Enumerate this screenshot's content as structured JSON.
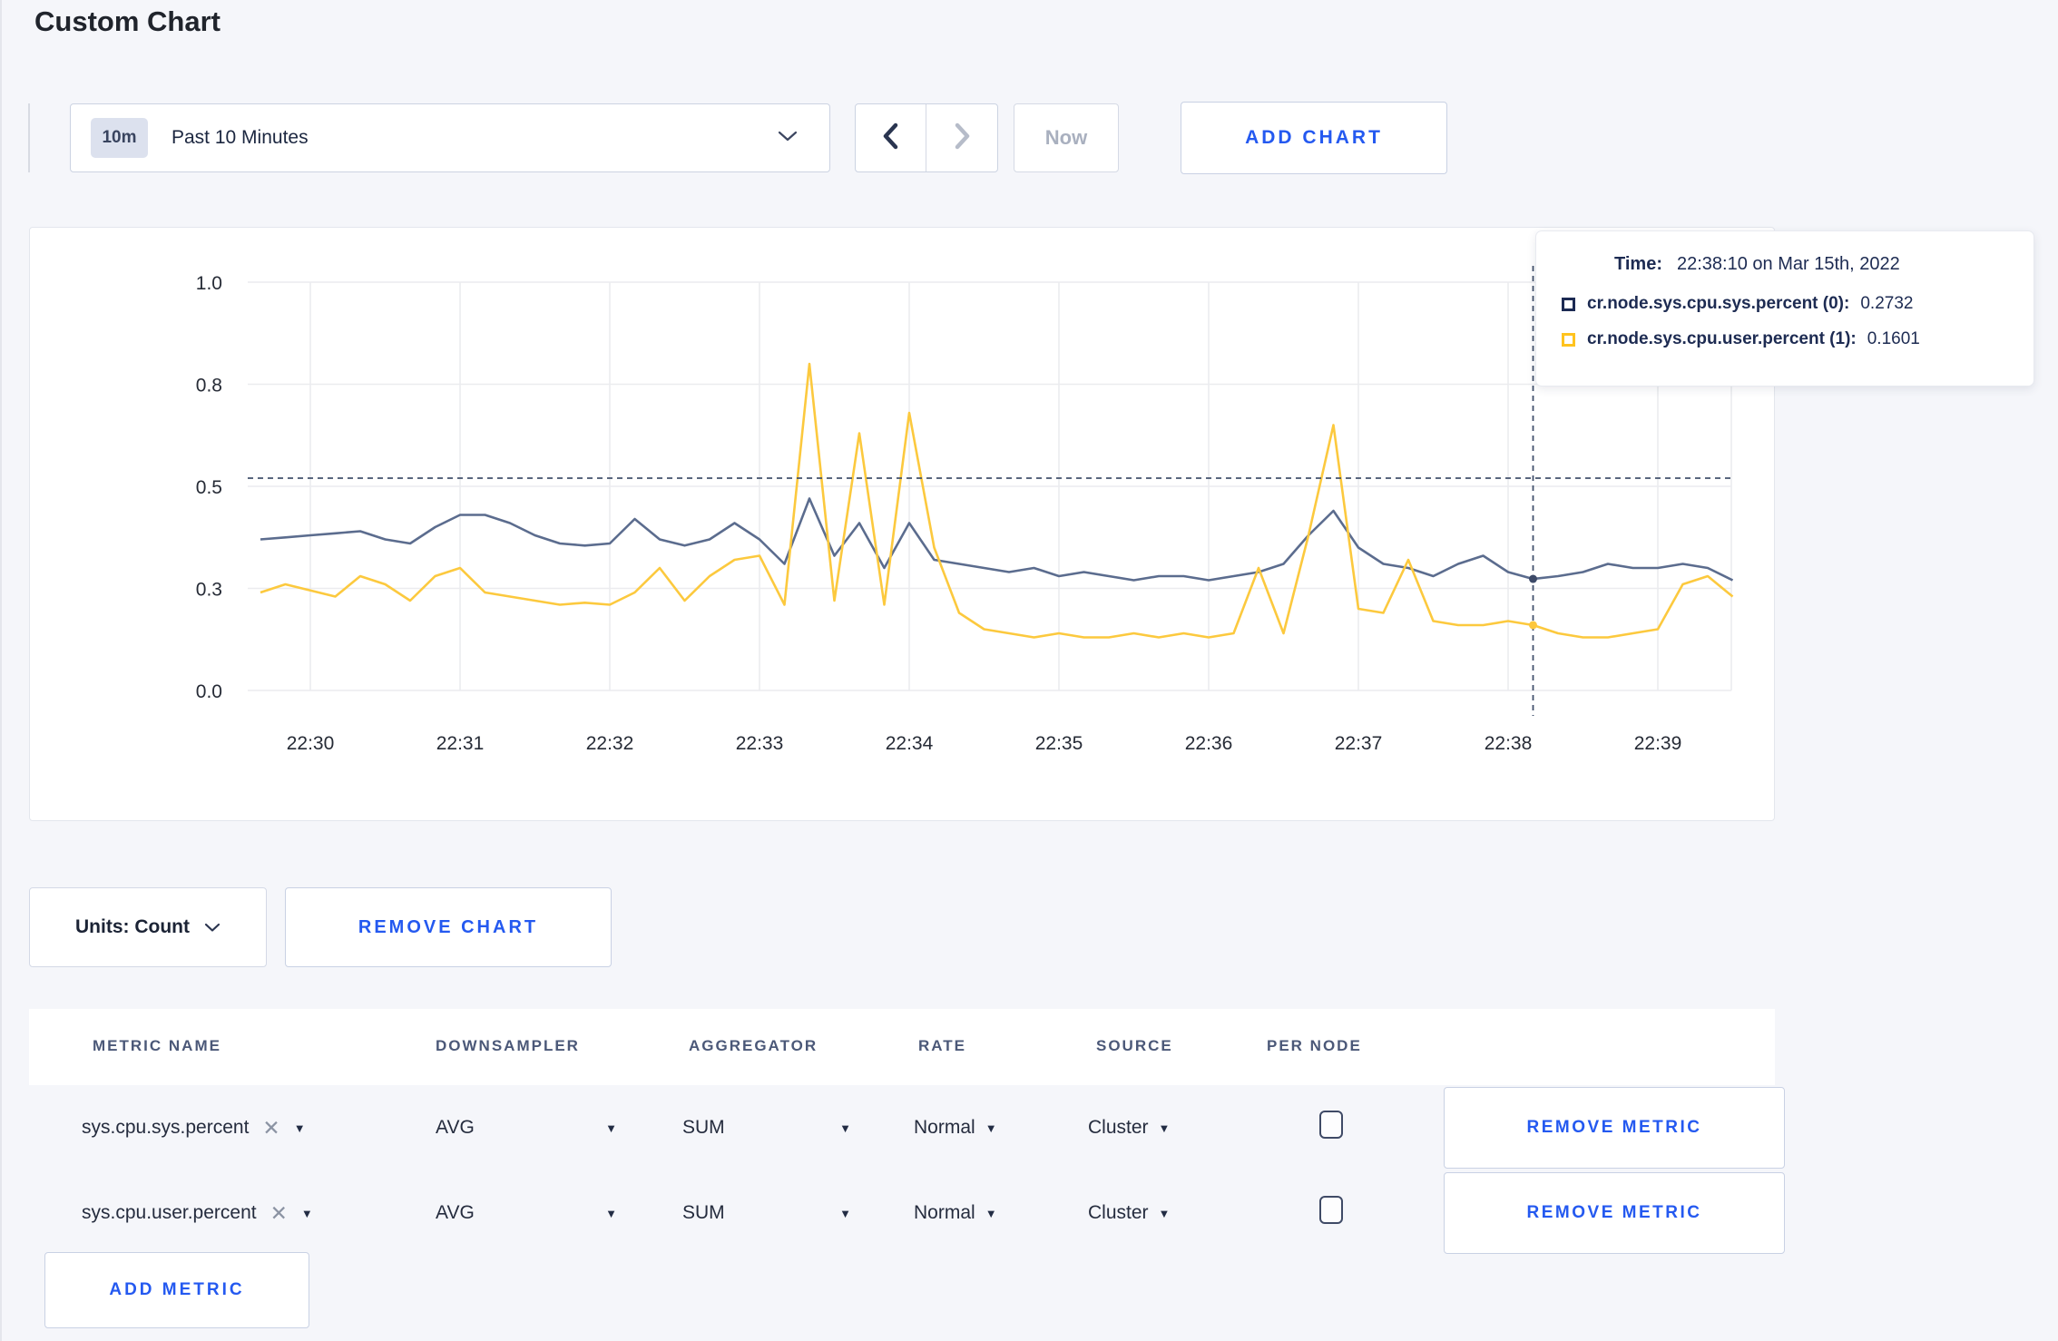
{
  "page": {
    "title": "Custom Chart"
  },
  "toolbar": {
    "range_badge": "10m",
    "range_label": "Past 10 Minutes",
    "now_label": "Now",
    "add_chart_label": "ADD CHART"
  },
  "icons": {
    "clear": "✕",
    "dropdown_arrow": "▼"
  },
  "tooltip": {
    "time_label": "Time:",
    "time_value": "22:38:10 on Mar 15th, 2022",
    "series": [
      {
        "label": "cr.node.sys.cpu.sys.percent (0):",
        "value": "0.2732",
        "color": "#1c2a53"
      },
      {
        "label": "cr.node.sys.cpu.user.percent (1):",
        "value": "0.1601",
        "color": "#ffc31e"
      }
    ]
  },
  "chart_controls": {
    "units_label": "Units: Count",
    "remove_chart_label": "REMOVE CHART"
  },
  "metrics_table": {
    "headers": [
      "METRIC NAME",
      "DOWNSAMPLER",
      "AGGREGATOR",
      "RATE",
      "SOURCE",
      "PER NODE"
    ],
    "rows": [
      {
        "metric": "sys.cpu.sys.percent",
        "downsampler": "AVG",
        "aggregator": "SUM",
        "rate": "Normal",
        "source": "Cluster",
        "per_node_checked": false,
        "remove_label": "REMOVE METRIC"
      },
      {
        "metric": "sys.cpu.user.percent",
        "downsampler": "AVG",
        "aggregator": "SUM",
        "rate": "Normal",
        "source": "Cluster",
        "per_node_checked": false,
        "remove_label": "REMOVE METRIC"
      }
    ],
    "add_metric_label": "ADD METRIC"
  },
  "chart_data": {
    "type": "line",
    "title": "",
    "xlabel": "",
    "ylabel": "",
    "grid": true,
    "legend_position": "none",
    "grid_color": "#ebecef",
    "x_axis": {
      "tick_labels": [
        "22:30",
        "22:31",
        "22:32",
        "22:33",
        "22:34",
        "22:35",
        "22:36",
        "22:37",
        "22:38",
        "22:39"
      ],
      "tick_interval_minutes": 1
    },
    "y_axis": {
      "domain": [
        0,
        1
      ],
      "ticks": [
        {
          "value": 0,
          "label": "0.0"
        },
        {
          "value": 0.25,
          "label": "0.3"
        },
        {
          "value": 0.5,
          "label": "0.5"
        },
        {
          "value": 0.75,
          "label": "0.8"
        },
        {
          "value": 1.0,
          "label": "1.0"
        }
      ]
    },
    "x_start_min": -0.3333333,
    "sample_interval_min": 0.1666667,
    "series": [
      {
        "name": "cr.node.sys.cpu.sys.percent (0)",
        "color": "#5b6c8e",
        "dot_color": "#3d4a68",
        "values": [
          0.37,
          0.375,
          0.38,
          0.385,
          0.39,
          0.37,
          0.36,
          0.4,
          0.43,
          0.43,
          0.41,
          0.38,
          0.36,
          0.355,
          0.36,
          0.42,
          0.37,
          0.355,
          0.37,
          0.41,
          0.37,
          0.31,
          0.47,
          0.33,
          0.41,
          0.3,
          0.41,
          0.32,
          0.31,
          0.3,
          0.29,
          0.3,
          0.28,
          0.29,
          0.28,
          0.27,
          0.28,
          0.28,
          0.27,
          0.28,
          0.29,
          0.31,
          0.38,
          0.44,
          0.35,
          0.31,
          0.3,
          0.28,
          0.31,
          0.33,
          0.29,
          0.2732,
          0.28,
          0.29,
          0.31,
          0.3,
          0.3,
          0.31,
          0.3,
          0.27
        ]
      },
      {
        "name": "cr.node.sys.cpu.user.percent (1)",
        "color": "#fcc93e",
        "dot_color": "#fdc73c",
        "values": [
          0.24,
          0.26,
          0.245,
          0.23,
          0.28,
          0.26,
          0.22,
          0.28,
          0.3,
          0.24,
          0.23,
          0.22,
          0.21,
          0.215,
          0.21,
          0.24,
          0.3,
          0.22,
          0.28,
          0.32,
          0.33,
          0.21,
          0.8,
          0.22,
          0.63,
          0.21,
          0.68,
          0.35,
          0.19,
          0.15,
          0.14,
          0.13,
          0.14,
          0.13,
          0.13,
          0.14,
          0.13,
          0.14,
          0.13,
          0.14,
          0.3,
          0.14,
          0.38,
          0.65,
          0.2,
          0.19,
          0.32,
          0.17,
          0.16,
          0.16,
          0.17,
          0.1601,
          0.14,
          0.13,
          0.13,
          0.14,
          0.15,
          0.26,
          0.28,
          0.23
        ]
      }
    ],
    "crosshair": {
      "time_min": 8.1666667,
      "index": 51,
      "hover_value": 0.52,
      "color": "#42506c"
    }
  }
}
